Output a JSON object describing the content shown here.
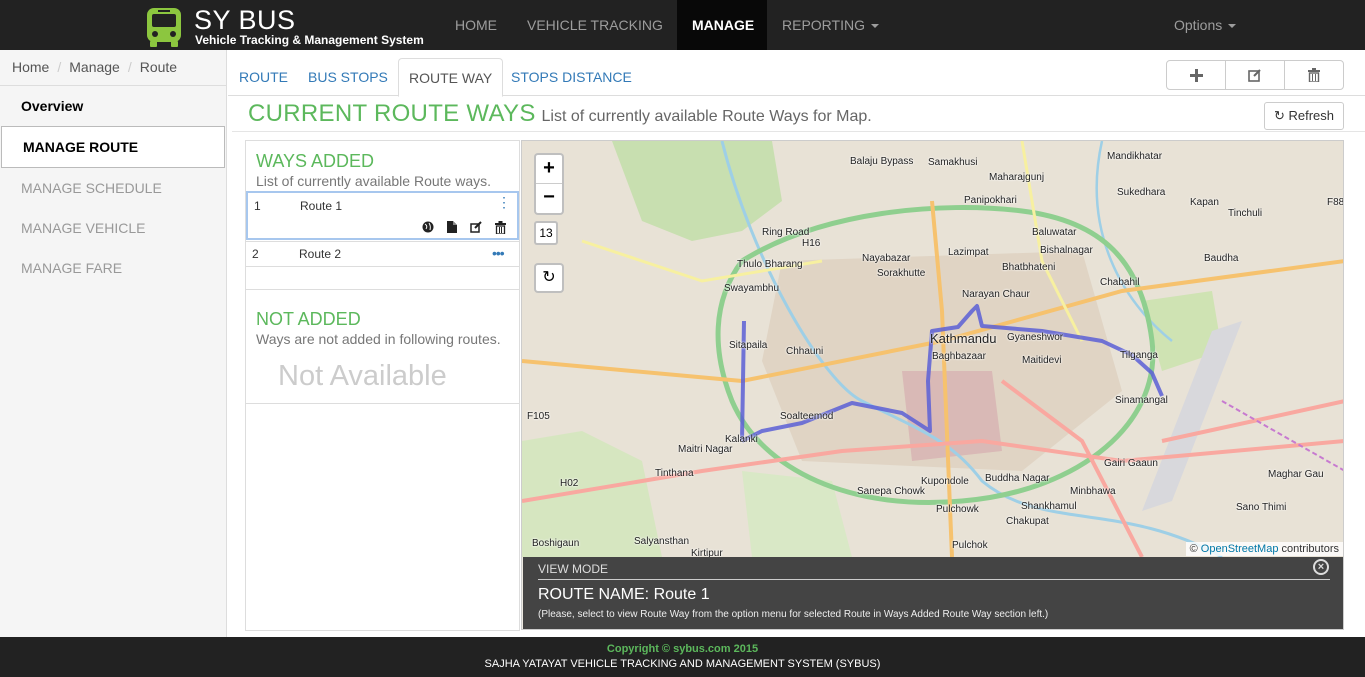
{
  "brand": {
    "title": "SY BUS",
    "subtitle": "Vehicle Tracking & Management System",
    "icon": "bus-icon",
    "accent": "#8cc63f"
  },
  "nav": {
    "items": [
      {
        "label": "HOME"
      },
      {
        "label": "VEHICLE TRACKING"
      },
      {
        "label": "MANAGE",
        "active": true
      },
      {
        "label": "REPORTING"
      }
    ],
    "options_label": "Options"
  },
  "breadcrumb": [
    "Home",
    "Manage",
    "Route"
  ],
  "sidebar": {
    "items": [
      {
        "label": "Overview"
      },
      {
        "label": "MANAGE ROUTE",
        "selected": true
      },
      {
        "label": "MANAGE SCHEDULE"
      },
      {
        "label": "MANAGE VEHICLE"
      },
      {
        "label": "MANAGE FARE"
      }
    ]
  },
  "tabs": [
    {
      "label": "ROUTE"
    },
    {
      "label": "BUS STOPS"
    },
    {
      "label": "ROUTE WAY",
      "active": true
    },
    {
      "label": "STOPS DISTANCE"
    }
  ],
  "toolbar": {
    "add": "plus-icon",
    "edit": "edit-icon",
    "delete": "trash-icon"
  },
  "header": {
    "title": "CURRENT ROUTE WAYS",
    "subtitle": "List of currently available Route Ways for Map.",
    "refresh_label": "Refresh"
  },
  "ways_added": {
    "title": "WAYS ADDED",
    "subtitle": "List of currently available Route ways.",
    "rows": [
      {
        "num": "1",
        "name": "Route 1"
      },
      {
        "num": "2",
        "name": "Route 2"
      }
    ]
  },
  "not_added": {
    "title": "NOT ADDED",
    "subtitle": "Ways are not added in following routes.",
    "empty_text": "Not Available"
  },
  "map": {
    "zoom_in": "+",
    "zoom_out": "−",
    "zoom_level": "13",
    "attribution_prefix": "©",
    "attribution_link": "OpenStreetMap",
    "attribution_suffix": "contributors",
    "places": [
      "Balaju Bypass",
      "Samakhusi",
      "Mandikhatar",
      "Maharajgunj",
      "Sukedhara",
      "Kapan",
      "Panipokhari",
      "Tinchuli",
      "Baluwatar",
      "Bishalnagar",
      "Nayabazar",
      "Lazimpat",
      "Sorakhutte",
      "Thulo Bharang",
      "Bhatbhateni",
      "Baudha",
      "Swayambhu",
      "Chabahil",
      "Narayan Chaur",
      "Kathmandu",
      "Gyaneshwor",
      "Sitapaila",
      "Chhauni",
      "Baghbazaar",
      "Maitidevi",
      "Tilganga",
      "Sinamangal",
      "Soalteemod",
      "Kalanki",
      "Maitri Nagar",
      "Gairi Gaaun",
      "Tinthana",
      "Kupondole",
      "Buddha Nagar",
      "Maghar Gau",
      "Sanepa Chowk",
      "Minbhawa",
      "Pulchowk",
      "Shankhamul",
      "Sano Thimi",
      "Chakupat",
      "Boshigaun",
      "Salyansthan",
      "Kirtipur",
      "Pulchok",
      "Ring Road",
      "H16",
      "H02",
      "F105",
      "F88"
    ],
    "route_color": "#5a5fd6"
  },
  "view_mode": {
    "label": "VIEW MODE",
    "route_name": "ROUTE NAME: Route 1",
    "note": "(Please, select to view Route Way from the option menu for selected Route in Ways Added Route Way section left.)"
  },
  "footer": {
    "copyright": "Copyright © sybus.com 2015",
    "system": "SAJHA YATAYAT VEHICLE TRACKING AND MANAGEMENT SYSTEM (SYBUS)"
  }
}
